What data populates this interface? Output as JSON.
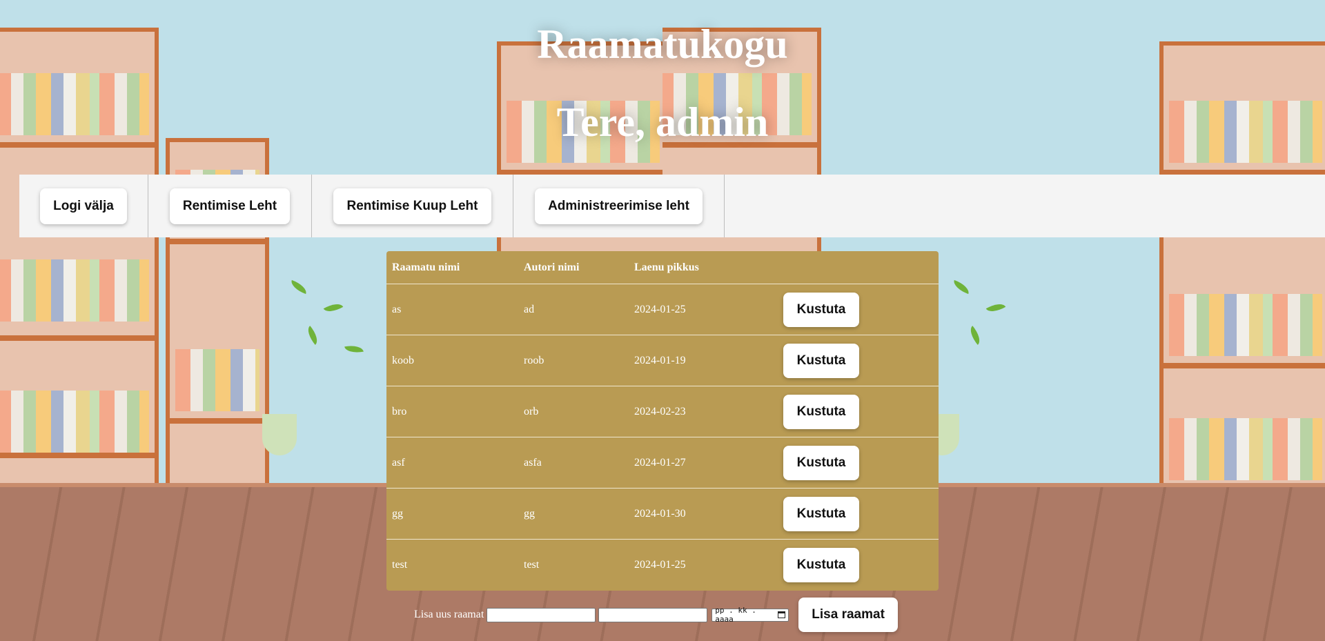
{
  "header": {
    "title": "Raamatukogu",
    "greeting": "Tere, admin"
  },
  "nav": {
    "items": [
      {
        "label": "Logi välja"
      },
      {
        "label": "Rentimise Leht"
      },
      {
        "label": "Rentimise Kuup Leht"
      },
      {
        "label": "Administreerimise leht"
      }
    ]
  },
  "table": {
    "columns": [
      "Raamatu nimi",
      "Autori nimi",
      "Laenu pikkus",
      ""
    ],
    "rows": [
      {
        "book": "as",
        "author": "ad",
        "date": "2024-01-25",
        "action": "Kustuta"
      },
      {
        "book": "koob",
        "author": "roob",
        "date": "2024-01-19",
        "action": "Kustuta"
      },
      {
        "book": "bro",
        "author": "orb",
        "date": "2024-02-23",
        "action": "Kustuta"
      },
      {
        "book": "asf",
        "author": "asfa",
        "date": "2024-01-27",
        "action": "Kustuta"
      },
      {
        "book": "gg",
        "author": "gg",
        "date": "2024-01-30",
        "action": "Kustuta"
      },
      {
        "book": "test",
        "author": "test",
        "date": "2024-01-25",
        "action": "Kustuta"
      }
    ]
  },
  "add_form": {
    "label": "Lisa uus raamat",
    "book_value": "",
    "author_value": "",
    "date_placeholder": "pp . kk . aaaa",
    "submit_label": "Lisa raamat"
  },
  "colors": {
    "table_bg": "#b99b53",
    "navbar_bg": "#f4f4f4",
    "sky": "#bfe0e9",
    "shelf_wood": "#c9713c"
  }
}
